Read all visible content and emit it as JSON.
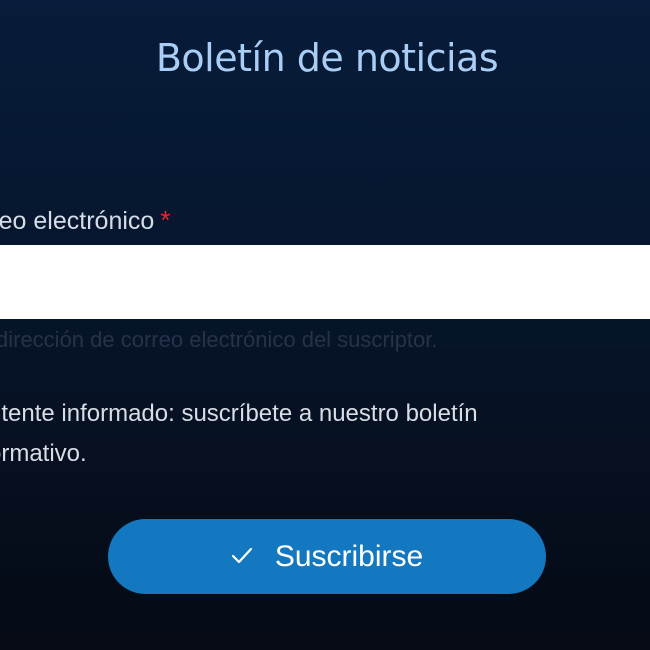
{
  "newsletter": {
    "title": "Boletín de noticias",
    "email_label": "rreo electrónico",
    "required_marker": "*",
    "email_value": "",
    "email_placeholder": "",
    "email_help": "dirección de correo electrónico del suscriptor.",
    "description": "ntente informado: suscríbete a nuestro boletín ormativo.",
    "description_line1": "ntente informado: suscríbete a nuestro boletín",
    "description_line2": "ormativo.",
    "submit_label": "Suscribirse",
    "submit_icon": "check-icon"
  },
  "colors": {
    "background_top": "#071c3a",
    "background_bottom": "#050a14",
    "title": "#a9cdf5",
    "required": "#e8262c",
    "button": "#1478c0",
    "button_text": "#ffffff"
  }
}
